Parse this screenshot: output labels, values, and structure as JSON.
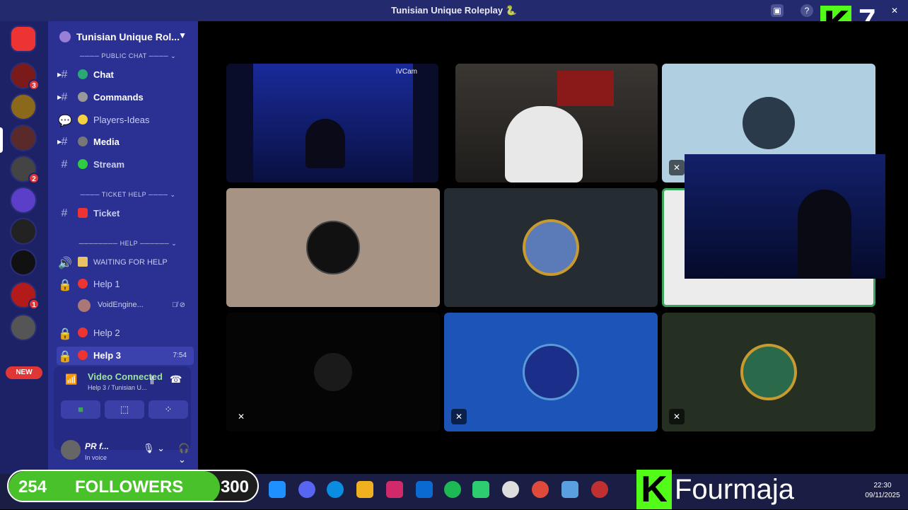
{
  "window": {
    "title": "Tunisian Unique Roleplay 🐍"
  },
  "overlay": {
    "kick_letter": "K",
    "kick_count": "7"
  },
  "server_rail": {
    "badges": [
      "3",
      "2",
      "1"
    ],
    "new_label": "NEW"
  },
  "server": {
    "name": "Tunisian Unique Rol..."
  },
  "categories": {
    "public_chat": "PUBLIC CHAT",
    "ticket_help": "TICKET HELP",
    "help": "HELP"
  },
  "channels": [
    {
      "name": "Chat",
      "type": "text"
    },
    {
      "name": "Commands",
      "type": "text"
    },
    {
      "name": "Players-Ideas",
      "type": "forum"
    },
    {
      "name": "Media",
      "type": "text"
    },
    {
      "name": "Stream",
      "type": "text"
    },
    {
      "name": "Ticket",
      "type": "text"
    },
    {
      "name": "WAITING FOR HELP",
      "type": "voice"
    },
    {
      "name": "Help 1",
      "type": "voice-locked"
    },
    {
      "name": "Help 2",
      "type": "voice-locked"
    },
    {
      "name": "Help 3",
      "type": "voice-locked",
      "time": "7:54"
    }
  ],
  "voice_user": {
    "name": "VoidEngine..."
  },
  "voice_panel": {
    "status": "Video Connected",
    "location": "Help 3 / Tunisian U..."
  },
  "user": {
    "name": "PR f...",
    "status": "In voice"
  },
  "tiles": [
    {
      "label": "iVCam"
    }
  ],
  "followers": {
    "current": "254",
    "label": "FOLLOWERS",
    "goal": "300",
    "progress": 0.85
  },
  "streamer": {
    "name": "Fourmaja"
  },
  "clock": {
    "time": "22:30",
    "date": "09/11/2025"
  }
}
